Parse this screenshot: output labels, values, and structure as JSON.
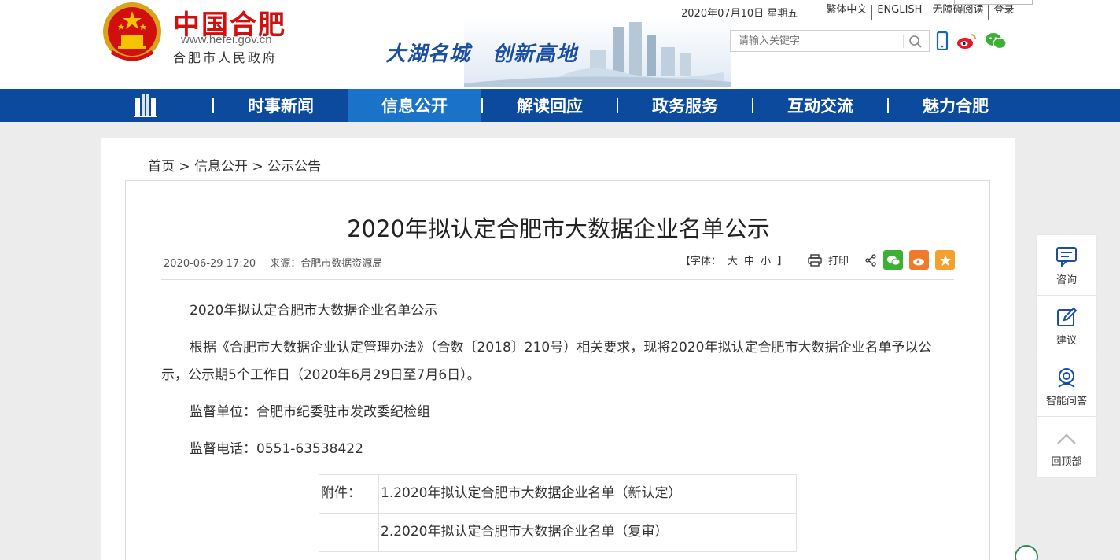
{
  "header": {
    "logo_title": "中国合肥",
    "logo_url": "www.hefei.gov.cn",
    "logo_sub": "合肥市人民政府",
    "slogan_1": "大湖名城",
    "slogan_2": "创新高地",
    "date": "2020年07月10日 星期五",
    "links": [
      "繁体中文",
      "ENGLISH",
      "无障碍阅读",
      "登录"
    ],
    "search_placeholder": "请输入关键字"
  },
  "nav": {
    "items": [
      {
        "label": "时事新闻",
        "active": false
      },
      {
        "label": "信息公开",
        "active": true
      },
      {
        "label": "解读回应",
        "active": false
      },
      {
        "label": "政务服务",
        "active": false
      },
      {
        "label": "互动交流",
        "active": false
      },
      {
        "label": "魅力合肥",
        "active": false
      }
    ]
  },
  "breadcrumb": {
    "home": "首页",
    "sep": " > ",
    "level1": "信息公开",
    "level2": "公示公告"
  },
  "article": {
    "title": "2020年拟认定合肥市大数据企业名单公示",
    "datetime": "2020-06-29 17:20",
    "source": "来源：合肥市数据资源局",
    "font_label": "【字体：",
    "font_large": "大",
    "font_medium": "中",
    "font_small": "小",
    "font_end": "】",
    "print_label": "打印",
    "paragraphs": [
      "2020年拟认定合肥市大数据企业名单公示",
      "根据《合肥市大数据企业认定管理办法》（合数〔2018〕210号）相关要求，现将2020年拟认定合肥市大数据企业名单予以公示，公示期5个工作日（2020年6月29日至7月6日）。",
      "监督单位：合肥市纪委驻市发改委纪检组",
      "监督电话：0551-63538422"
    ],
    "attachment_label": "附件：",
    "attachments": [
      "1.2020年拟认定合肥市大数据企业名单（新认定）",
      "2.2020年拟认定合肥市大数据企业名单（复审）"
    ]
  },
  "float_bar": {
    "consult": "咨询",
    "suggest": "建议",
    "smart_qa": "智能问答",
    "back_top": "回顶部"
  },
  "colors": {
    "brand_red": "#d20f0f",
    "nav_blue": "#0b4a9c",
    "nav_active": "#1a73c9",
    "wechat_green": "#3cb034",
    "weibo_orange": "#f07a2b",
    "favorite_orange": "#f2a12f"
  }
}
